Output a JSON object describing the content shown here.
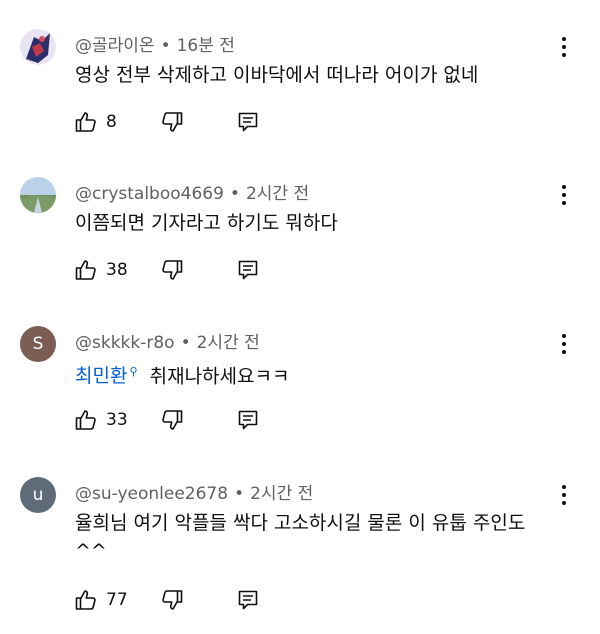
{
  "comments": [
    {
      "author": "@골라이온",
      "time": "16분 전",
      "text": "영상 전부 삭제하고 이바닥에서 떠나라 어이가 없네",
      "likes": "8",
      "avatar": {
        "type": "image",
        "colors": [
          "#2b2f6a",
          "#c03a4a",
          "#e6e0f0"
        ]
      }
    },
    {
      "author": "@crystalboo4669",
      "time": "2시간 전",
      "text": "이쯤되면 기자라고 하기도 뭐하다",
      "likes": "38",
      "avatar": {
        "type": "image",
        "colors": [
          "#8fb3d9",
          "#6f8f5a",
          "#c8d6e4"
        ]
      }
    },
    {
      "author": "@skkkk-r8o",
      "time": "2시간 전",
      "mention": "최민환",
      "text": "취재나하세요ㅋㅋ",
      "likes": "33",
      "avatar": {
        "type": "letter",
        "letter": "S",
        "color": "#7a5d53"
      }
    },
    {
      "author": "@su-yeonlee2678",
      "time": "2시간 전",
      "text": "율희님 여기 악플들 싹다 고소하시길 물론 이 유툽 주인도 ^^",
      "likes": "77",
      "avatar": {
        "type": "letter",
        "letter": "u",
        "color": "#5f6b79"
      }
    }
  ],
  "separator": "•",
  "icons": {
    "like": "thumbs-up-icon",
    "dislike": "thumbs-down-icon",
    "reply": "reply-icon",
    "menu": "more-vertical-icon",
    "mention_marker": "search-icon"
  }
}
